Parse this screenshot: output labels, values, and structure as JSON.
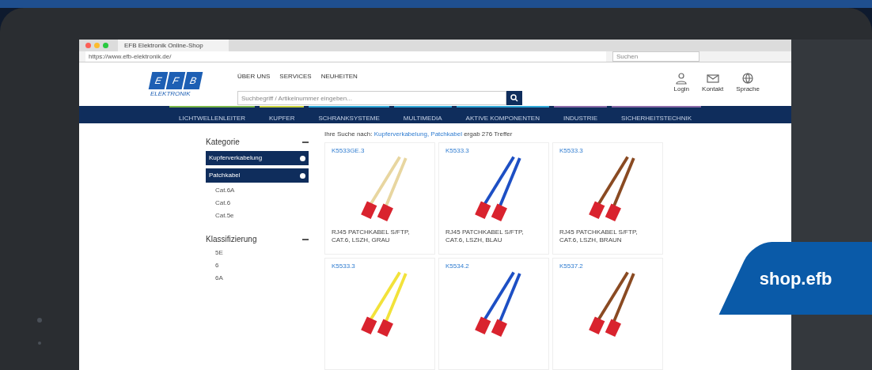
{
  "browser": {
    "tab_title": "EFB Elektronik Online-Shop",
    "url": "https://www.efb-elektronik.de/",
    "search_placeholder": "Suchen"
  },
  "header": {
    "logo_letters": [
      "E",
      "F",
      "B"
    ],
    "logo_text": "ELEKTRONIK",
    "links": [
      "ÜBER UNS",
      "SERVICES",
      "NEUHEITEN"
    ],
    "actions": [
      {
        "kind": "user",
        "label": "Login"
      },
      {
        "kind": "mail",
        "label": "Kontakt"
      },
      {
        "kind": "globe",
        "label": "Sprache"
      }
    ],
    "search_placeholder": "Suchbegriff / Artikelnummer eingeben..."
  },
  "nav": [
    {
      "label": "LICHTWELLENLEITER",
      "color": "#7ab648"
    },
    {
      "label": "KUPFER",
      "color": "#c8d23c"
    },
    {
      "label": "SCHRANKSYSTEME",
      "color": "#2fa8d8"
    },
    {
      "label": "MULTIMEDIA",
      "color": "#2fa8d8"
    },
    {
      "label": "AKTIVE KOMPONENTEN",
      "color": "#2fa8d8"
    },
    {
      "label": "INDUSTRIE",
      "color": "#8a6aa8"
    },
    {
      "label": "SICHERHEITSTECHNIK",
      "color": "#8a6aa8"
    }
  ],
  "sidebar": {
    "sections": [
      {
        "title": "Kategorie",
        "expanded": true,
        "filters": [
          "Kupferverkabelung",
          "Patchkabel"
        ],
        "items": [
          "Cat.6A",
          "Cat.6",
          "Cat.5e"
        ]
      },
      {
        "title": "Klassifizierung",
        "expanded": true,
        "items": [
          "5E",
          "6",
          "6A"
        ]
      }
    ]
  },
  "results": {
    "prefix": "Ihre Suche nach:",
    "query": "Kupferverkabelung, Patchkabel",
    "suffix": "ergab 276 Treffer"
  },
  "products": [
    {
      "code": "K5533GE.3",
      "name": "RJ45 PATCHKABEL S/FTP, CAT.6, LSZH, GRAU",
      "color": "#e8d6a0"
    },
    {
      "code": "K5533.3",
      "name": "RJ45 PATCHKABEL S/FTP, CAT.6, LSZH, BLAU",
      "color": "#1d4fc4"
    },
    {
      "code": "K5533.3",
      "name": "RJ45 PATCHKABEL S/FTP, CAT.6, LSZH, BRAUN",
      "color": "#8a4a22"
    },
    {
      "code": "K5533.3",
      "color": "#f2e23a"
    },
    {
      "code": "K5534.2",
      "color": "#1d4fc4"
    },
    {
      "code": "K5537.2",
      "color": "#8a4a22"
    }
  ],
  "banner": {
    "text": "shop.efb"
  }
}
